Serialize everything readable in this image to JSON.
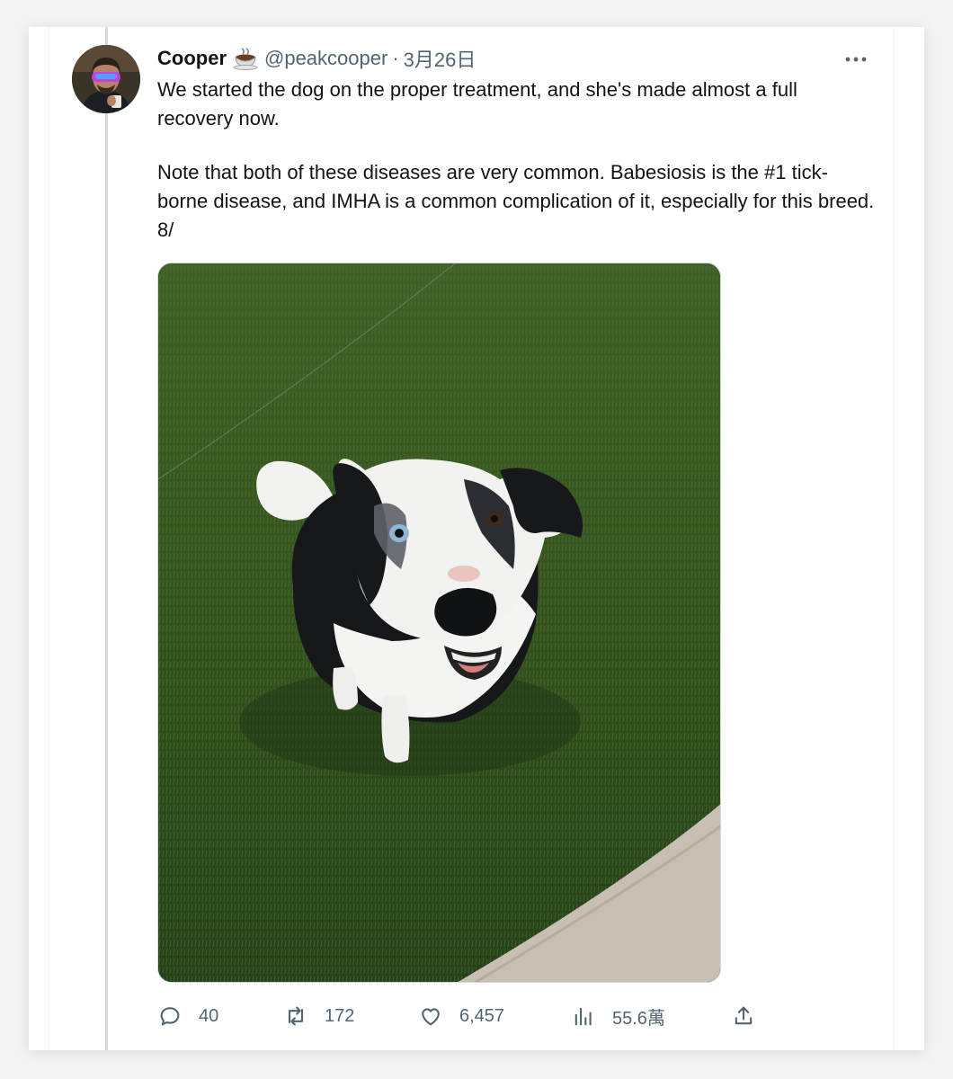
{
  "tweet": {
    "author_name": "Cooper",
    "author_emoji": "coffee-cup-icon",
    "handle": "@peakcooper",
    "separator": "·",
    "date": "3月26日",
    "more_icon": "more-horizontal-icon",
    "paragraphs": [
      "We started the dog on the proper treatment, and she's made almost a full recovery now.",
      "Note that both of these diseases are very common. Babesiosis is the #1 tick-borne disease, and IMHA is a common complication of it, especially for this breed. 8/"
    ],
    "media": {
      "kind": "photo",
      "subject": "border-collie-on-grass"
    },
    "actions": {
      "replies": "40",
      "reposts": "172",
      "likes": "6,457",
      "views": "55.6萬"
    }
  },
  "colors": {
    "text_primary": "#0f1419",
    "text_secondary": "#536471",
    "thread_line": "#cfd9de"
  }
}
